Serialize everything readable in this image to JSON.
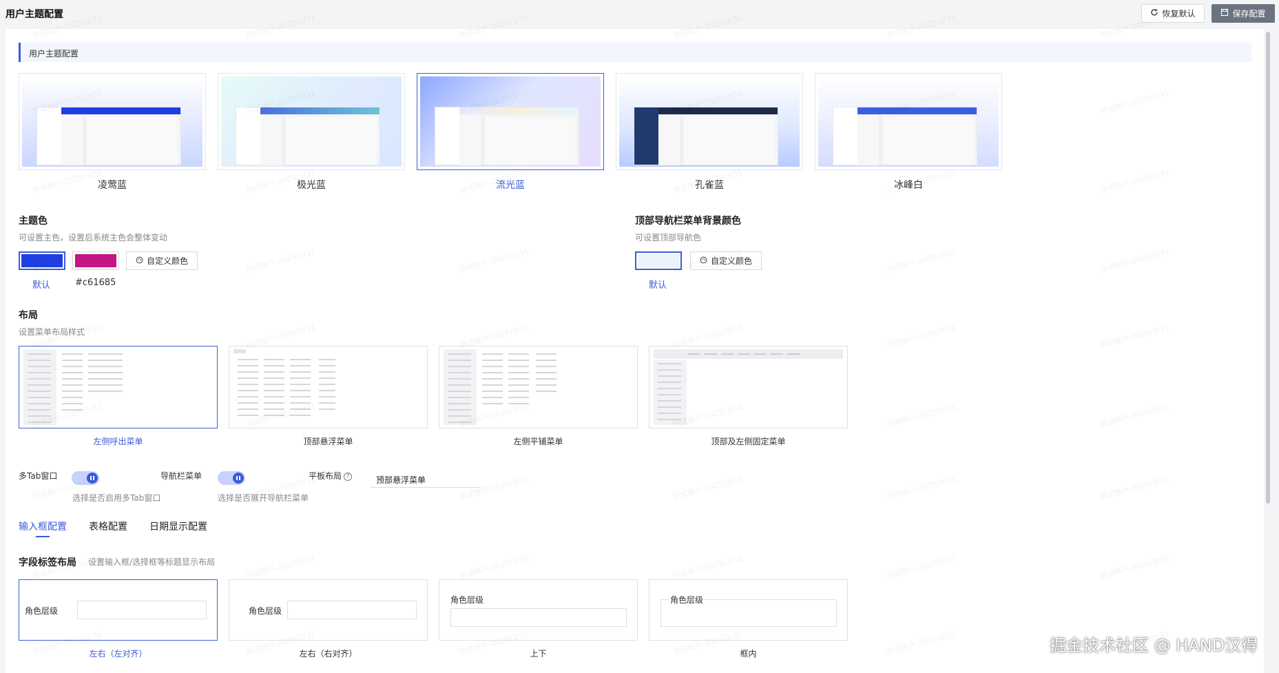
{
  "header": {
    "title": "用户主题配置",
    "reset_label": "恢复默认",
    "save_label": "保存配置"
  },
  "section": {
    "title": "用户主题配置"
  },
  "themes": [
    {
      "label": "凌莺蓝",
      "selected": false,
      "bar": "#1e40e0",
      "side": "#ffffff",
      "bg": "linear-gradient(180deg,#fff 0%,#dfe6ff 60%,#c9d6ff 100%)"
    },
    {
      "label": "极光蓝",
      "selected": false,
      "bar": "linear-gradient(90deg,#4b6fe0,#6cc3d5)",
      "side": "#ffffff",
      "bg": "linear-gradient(135deg,#e6fbf8 0%,#dfeafe 60%,#d9e7ff 100%)"
    },
    {
      "label": "流光蓝",
      "selected": true,
      "bar": "linear-gradient(90deg,#e8ecff,#f7f0d8,#e2f4ff)",
      "side": "#ffffff",
      "bg": "linear-gradient(135deg,#8ea7ff 0%,#dfe6ff 45%,#e8dcff 100%)"
    },
    {
      "label": "孔雀蓝",
      "selected": false,
      "bar": "#1e2a4a",
      "side": "#213a6e",
      "bg": "linear-gradient(180deg,#fff 0%,#dbe6ff 60%,#b8cbff 100%)"
    },
    {
      "label": "冰峰白",
      "selected": false,
      "bar": "#3b5fe0",
      "side": "#ffffff",
      "bg": "linear-gradient(180deg,#fff 0%,#e7ebff 60%,#d3dcff 100%)"
    }
  ],
  "primary": {
    "title": "主题色",
    "desc": "可设置主色，设置后系统主色会整体变动",
    "swatches": [
      {
        "color": "#1f3fe0",
        "caption": "默认"
      },
      {
        "color": "#c61685",
        "caption": "#c61685"
      }
    ],
    "custom_label": "自定义颜色"
  },
  "navbg": {
    "title": "顶部导航栏菜单背景颜色",
    "desc": "可设置顶部导航色",
    "swatch_color": "#eef2fb",
    "caption": "默认",
    "custom_label": "自定义颜色"
  },
  "layout": {
    "title": "布局",
    "desc": "设置菜单布局样式",
    "cards": [
      {
        "label": "左侧呼出菜单"
      },
      {
        "label": "顶部悬浮菜单"
      },
      {
        "label": "左侧平铺菜单"
      },
      {
        "label": "顶部及左侧固定菜单"
      }
    ]
  },
  "options": {
    "multitab": {
      "label": "多Tab窗口",
      "desc": "选择是否启用多Tab窗口",
      "on": true
    },
    "navmenu": {
      "label": "导航栏菜单",
      "desc": "选择是否展开导航栏菜单",
      "on": true
    },
    "tablet": {
      "label": "平板布局",
      "help": "?",
      "value": "顶部悬浮菜单",
      "chevron": "⌄"
    }
  },
  "tabs": [
    "输入框配置",
    "表格配置",
    "日期显示配置"
  ],
  "field": {
    "title": "字段标签布局",
    "desc": "设置输入框/选择框等标题显示布局",
    "sample_label": "角色层级",
    "cards": [
      "左右（左对齐）",
      "左右（右对齐）",
      "上下",
      "框内"
    ]
  },
  "brand": "掘金技术社区 @ HAND汉得",
  "watermark": "测试账户-2025/3/31",
  "colors": {
    "accent": "#3b5bdb"
  }
}
